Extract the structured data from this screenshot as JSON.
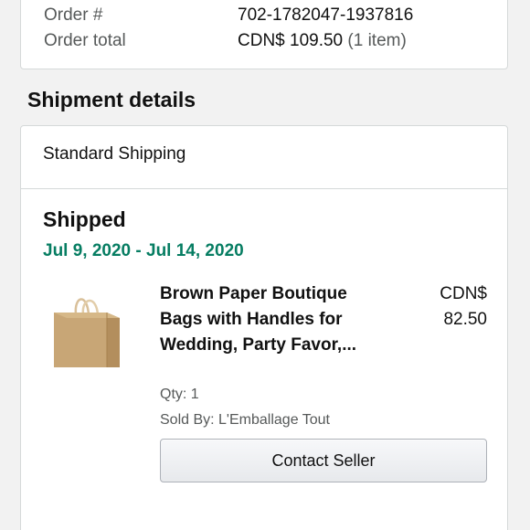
{
  "order_summary": {
    "order_number_label": "Order #",
    "order_number_value": "702-1782047-1937816",
    "order_total_label": "Order total",
    "order_total_value": "CDN$ 109.50",
    "order_total_items": "(1 item)"
  },
  "shipment": {
    "section_title": "Shipment details",
    "method": "Standard Shipping",
    "status": "Shipped",
    "delivery_window": "Jul 9, 2020 - Jul 14, 2020",
    "item": {
      "image_icon": "brown-paper-bag",
      "title": "Brown Paper Boutique Bags with Handles for Wedding, Party Favor,...",
      "price_currency": "CDN$",
      "price_amount": "82.50",
      "qty": "Qty: 1",
      "sold_by": "Sold By: L'Emballage Tout"
    },
    "contact_button_label": "Contact Seller"
  },
  "colors": {
    "delivery_date_green": "#067d62",
    "bag_brown": "#c9a77a"
  }
}
